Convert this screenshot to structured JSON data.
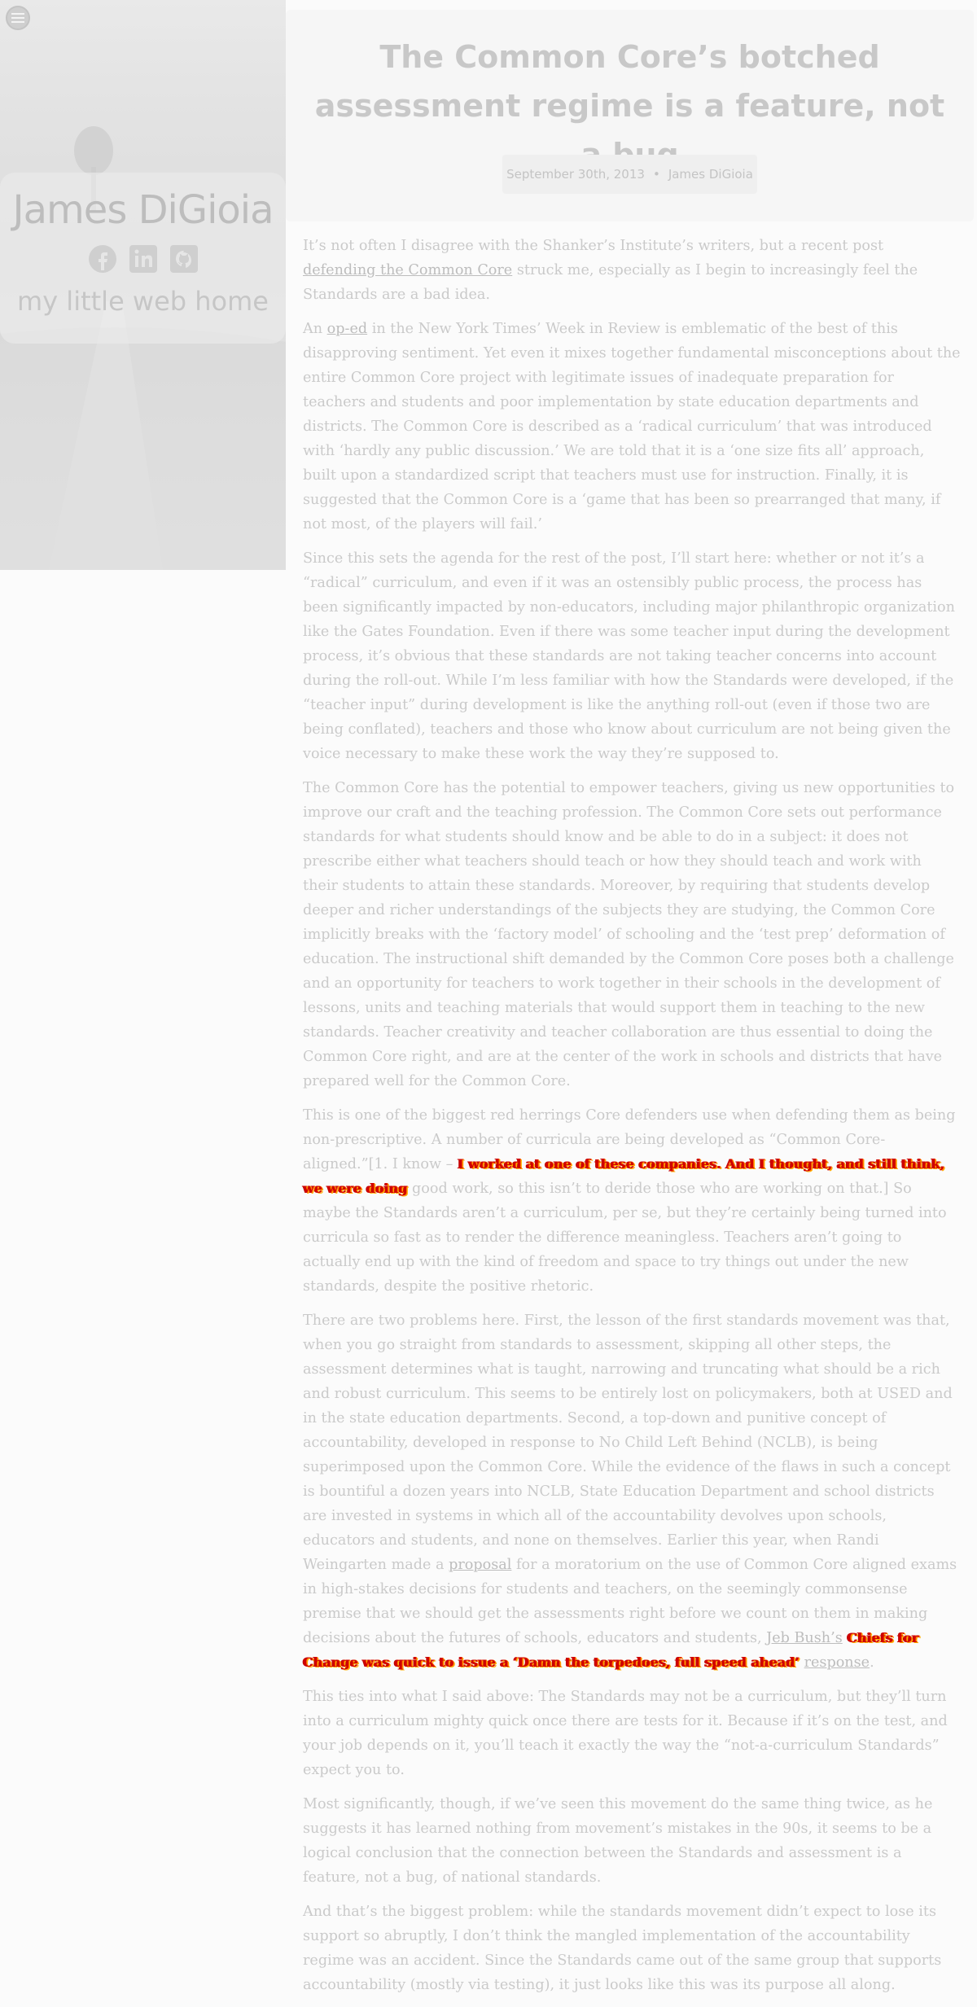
{
  "sidebar": {
    "site_title": "James DiGioia",
    "tagline": "my little web home",
    "social_icons": [
      "facebook-icon",
      "linkedin-icon",
      "github-icon"
    ],
    "menu_icon": "menu-icon"
  },
  "post": {
    "title": "The Common Core’s botched assessment regime is a feature, not a bug",
    "date": "September 30th, 2013",
    "separator": "•",
    "author": "James DiGioia"
  },
  "article": {
    "p1": {
      "a": "It’s not often I disagree with the Shanker’s Institute’s writers, but a recent post ",
      "link": "defending the Common Core",
      "b": " struck me, especially as I begin to increasingly feel the Standards are a bad idea."
    },
    "p2": {
      "a": "An ",
      "link": "op-ed",
      "b": " in the New York Times’ Week in Review is emblematic of the best of this disapproving sentiment. Yet even it mixes together fundamental misconceptions about the entire Common Core project with legitimate issues of inadequate preparation for teachers and students and poor implementation by state education departments and districts. The Common Core is described as a ‘radical curriculum’ that was introduced with ‘hardly any public discussion.’ We are told that it is a ‘one size fits all’ approach, built upon a standardized script that teachers must use for instruction. Finally, it is suggested that the Common Core is a ‘game that has been so prearranged that many, if not most, of the players will fail.’"
    },
    "p3": "Since this sets the agenda for the rest of the post, I’ll start here: whether or not it’s a “radical” curriculum, and even if it was an ostensibly public process, the process has been significantly impacted by non-educators, including major philanthropic organization like the Gates Foundation. Even if there was some teacher input during the development process, it’s obvious that these standards are not taking teacher concerns into account during the roll-out. While I’m less familiar with how the Standards were developed, if the “teacher input” during development is like the anything roll-out (even if those two are being conflated), teachers and those who know about curriculum are not being given the voice necessary to make these work the way they’re supposed to.",
    "p4": "The Common Core has the potential to empower teachers, giving us new opportunities to improve our craft and the teaching profession. The Common Core sets out performance standards for what students should know and be able to do in a subject: it does not prescribe either what teachers should teach or how they should teach and work with their students to attain these standards. Moreover, by requiring that students develop deeper and richer understandings of the subjects they are studying, the Common Core implicitly breaks with the ‘factory model’ of schooling and the ‘test prep’ deformation of education. The instructional shift demanded by the Common Core poses both a challenge and an opportunity for teachers to work together in their schools in the development of lessons, units and teaching materials that would support them in teaching to the new standards. Teacher creativity and teacher collaboration are thus essential to doing the Common Core right, and are at the center of the work in schools and districts that have prepared well for the Common Core.",
    "p5": {
      "a": "This is one of the biggest red herrings Core defenders use when defending them as being non-prescriptive. A number of curricula are being developed as “Common Core-aligned.”[1. I know – ",
      "note": "I worked at one of these companies. And I thought, and still think, we were doing",
      "b": " good work, so this isn’t to deride those who are working on that.] So maybe the Standards aren’t a curriculum, per se, but they’re certainly being turned into curricula so fast as to render the difference meaningless. Teachers aren’t going to actually end up with the kind of freedom and space to try things out under the new standards, despite the positive rhetoric."
    },
    "p6": {
      "a": "There are two problems here. First, the lesson of the first standards movement was that, when you go straight from standards to assessment, skipping all other steps, the assessment determines what is taught, narrowing and truncating what should be a rich and robust curriculum. This seems to be entirely lost on policymakers, both at USED and in the state education departments. Second, a top-down and punitive concept of accountability, developed in response to No Child Left Behind (NCLB), is being superimposed upon the Common Core. While the evidence of the flaws in such a concept is bountiful a dozen years into NCLB, State Education Department and school districts are invested in systems in which all of the accountability devolves upon schools, educators and students, and none on themselves. Earlier this year, when Randi Weingarten made a ",
      "link1": "proposal",
      "b": " for a moratorium on the use of Common Core aligned exams in high-stakes decisions for students and teachers, on the seemingly commonsense premise that we should get the assessments right before we count on them in making decisions about the futures of schools, educators and students, ",
      "link2": "Jeb Bush’s",
      "c": " ",
      "note": "Chiefs for Change was quick to issue a ‘Damn the torpedoes, full speed ahead’",
      "d": " ",
      "link3": "response",
      "e": "."
    },
    "p7": "This ties into what I said above: The Standards may not be a curriculum, but they’ll turn into a curriculum mighty quick once there are tests for it. Because if it’s on the test, and your job depends on it, you’ll teach it exactly the way the “not-a-curriculum Standards” expect you to.",
    "p8": "Most significantly, though, if we’ve seen this movement do the same thing twice, as he suggests it has learned nothing from movement’s mistakes in the 90s, it seems to be a logical conclusion that the connection between the Standards and assessment is a feature, not a bug, of national standards.",
    "p9": "And that’s the biggest problem: while the standards movement didn’t expect to lose its support so abruptly, I don’t think the mangled implementation of the accountability regime was an accident. Since the Standards came out of the same group that supports accountability (mostly via testing), it just looks like this was its purpose all along."
  }
}
